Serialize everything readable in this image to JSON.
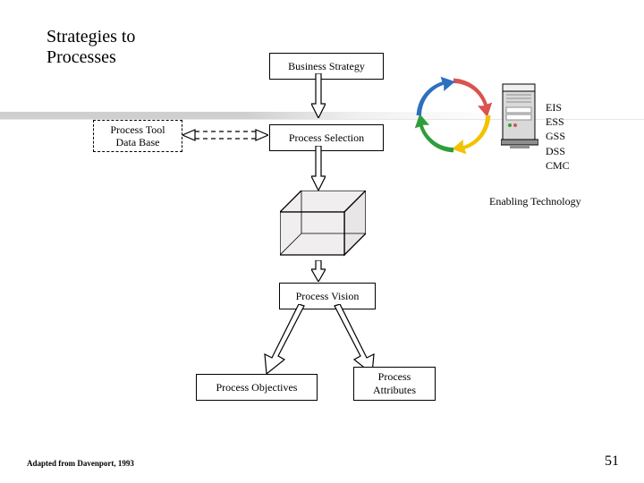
{
  "title_line1": "Strategies to",
  "title_line2": "Processes",
  "nodes": {
    "business_strategy": "Business Strategy",
    "process_tool_l1": "Process Tool",
    "process_tool_l2": "Data Base",
    "process_selection": "Process Selection",
    "process_vision": "Process Vision",
    "process_objectives": "Process Objectives",
    "process_attr_l1": "Process",
    "process_attr_l2": "Attributes"
  },
  "tech": {
    "heading": "Enabling Technology",
    "items": [
      "EIS",
      "ESS",
      "GSS",
      "DSS",
      "CMC"
    ]
  },
  "footer": "Adapted from Davenport, 1993",
  "slide_number": "51",
  "colors": {
    "cycle_red": "#d9534f",
    "cycle_yellow": "#f2c200",
    "cycle_green": "#2e9e3a",
    "cycle_blue": "#2f6fbf",
    "cube_fill": "#f0eeee",
    "cube_stroke": "#000000",
    "server_body": "#d9d9d9",
    "server_dark": "#8f8f8f"
  }
}
